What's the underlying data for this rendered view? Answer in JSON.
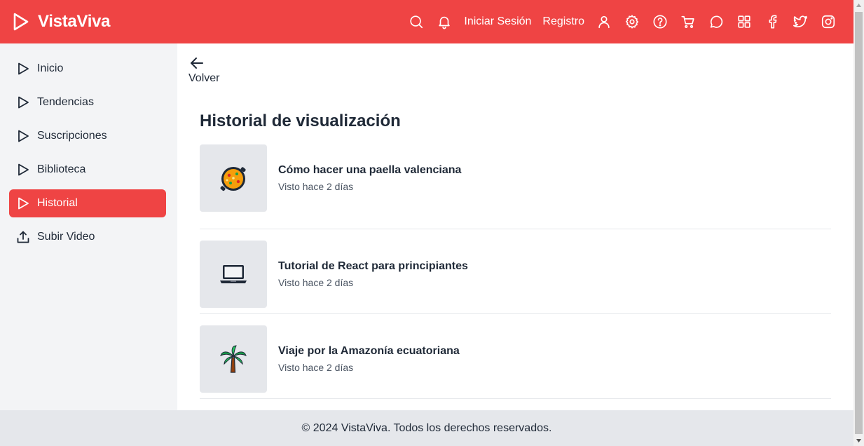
{
  "header": {
    "brand": "VistaViva",
    "login": "Iniciar Sesión",
    "register": "Registro",
    "icons": [
      "search-icon",
      "bell-icon",
      "user-icon",
      "gear-icon",
      "help-icon",
      "cart-icon",
      "chat-icon",
      "grid-icon",
      "facebook-icon",
      "twitter-icon",
      "instagram-icon"
    ],
    "color": "#ef4444"
  },
  "sidebar": {
    "items": [
      {
        "label": "Inicio",
        "icon": "play-icon"
      },
      {
        "label": "Tendencias",
        "icon": "play-icon"
      },
      {
        "label": "Suscripciones",
        "icon": "play-icon"
      },
      {
        "label": "Biblioteca",
        "icon": "play-icon"
      },
      {
        "label": "Historial",
        "icon": "play-icon",
        "active": true
      },
      {
        "label": "Subir Video",
        "icon": "upload-icon"
      }
    ]
  },
  "main": {
    "back_label": "Volver",
    "title": "Historial de visualización",
    "history": [
      {
        "title": "Cómo hacer una paella valenciana",
        "watched": "Visto hace 2 días",
        "thumb": "paella-icon"
      },
      {
        "title": "Tutorial de React para principiantes",
        "watched": "Visto hace 2 días",
        "thumb": "laptop-icon"
      },
      {
        "title": "Viaje por la Amazonía ecuatoriana",
        "watched": "Visto hace 2 días",
        "thumb": "palm-tree-icon"
      }
    ]
  },
  "footer": {
    "text": "© 2024 VistaViva. Todos los derechos reservados."
  }
}
